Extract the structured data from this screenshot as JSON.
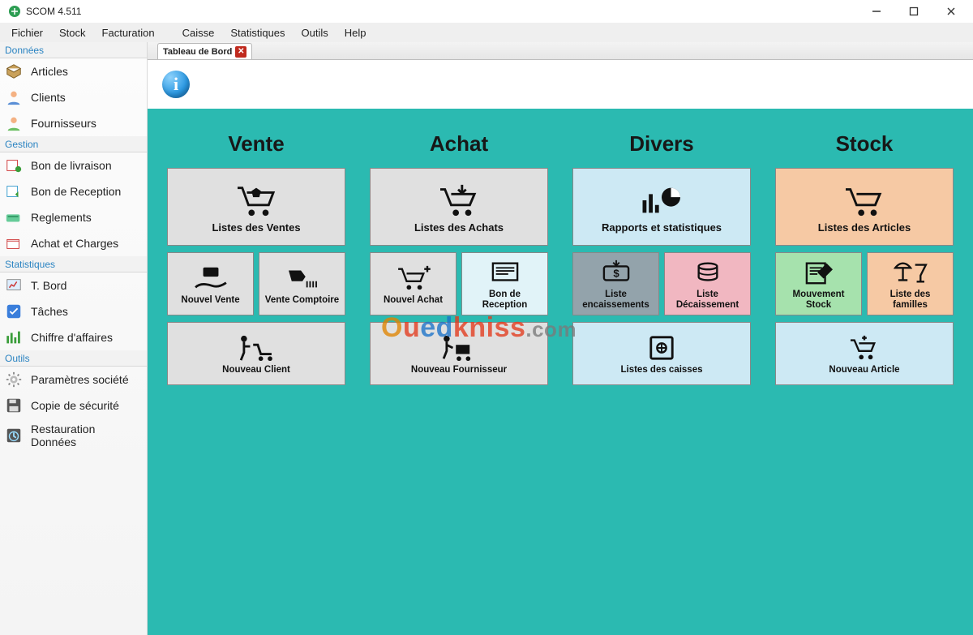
{
  "window": {
    "title": "SCOM 4.511"
  },
  "menubar": [
    "Fichier",
    "Stock",
    "Facturation",
    "Caisse",
    "Statistiques",
    "Outils",
    "Help"
  ],
  "sidebar": {
    "sections": [
      {
        "header": "Données",
        "items": [
          "Articles",
          "Clients",
          "Fournisseurs"
        ]
      },
      {
        "header": "Gestion",
        "items": [
          "Bon de livraison",
          "Bon de Reception",
          "Reglements",
          "Achat et Charges"
        ]
      },
      {
        "header": "Statistiques",
        "items": [
          "T. Bord",
          "Tâches",
          "Chiffre d'affaires"
        ]
      },
      {
        "header": "Outils",
        "items": [
          "Paramètres société",
          "Copie de sécurité",
          "Restauration Données"
        ]
      }
    ]
  },
  "tab": {
    "label": "Tableau de Bord"
  },
  "dashboard": {
    "columns": [
      {
        "title": "Vente",
        "big": {
          "label": "Listes des Ventes"
        },
        "pair": [
          {
            "label": "Nouvel Vente"
          },
          {
            "label": "Vente Comptoire"
          }
        ],
        "bottom": {
          "label": "Nouveau Client"
        }
      },
      {
        "title": "Achat",
        "big": {
          "label": "Listes des Achats"
        },
        "pair": [
          {
            "label": "Nouvel Achat"
          },
          {
            "label": "Bon de Reception"
          }
        ],
        "bottom": {
          "label": "Nouveau Fournisseur"
        }
      },
      {
        "title": "Divers",
        "big": {
          "label": "Rapports et statistiques"
        },
        "pair": [
          {
            "label": "Liste encaissements"
          },
          {
            "label": "Liste Décaissement"
          }
        ],
        "bottom": {
          "label": "Listes des caisses"
        }
      },
      {
        "title": "Stock",
        "big": {
          "label": "Listes des Articles"
        },
        "pair": [
          {
            "label": "Mouvement Stock"
          },
          {
            "label": "Liste des familles"
          }
        ],
        "bottom": {
          "label": "Nouveau Article"
        }
      }
    ]
  },
  "watermark": {
    "part1": "O",
    "part2": "u",
    "part3": "ed",
    "part4": "kniss",
    "dom": ".com"
  }
}
